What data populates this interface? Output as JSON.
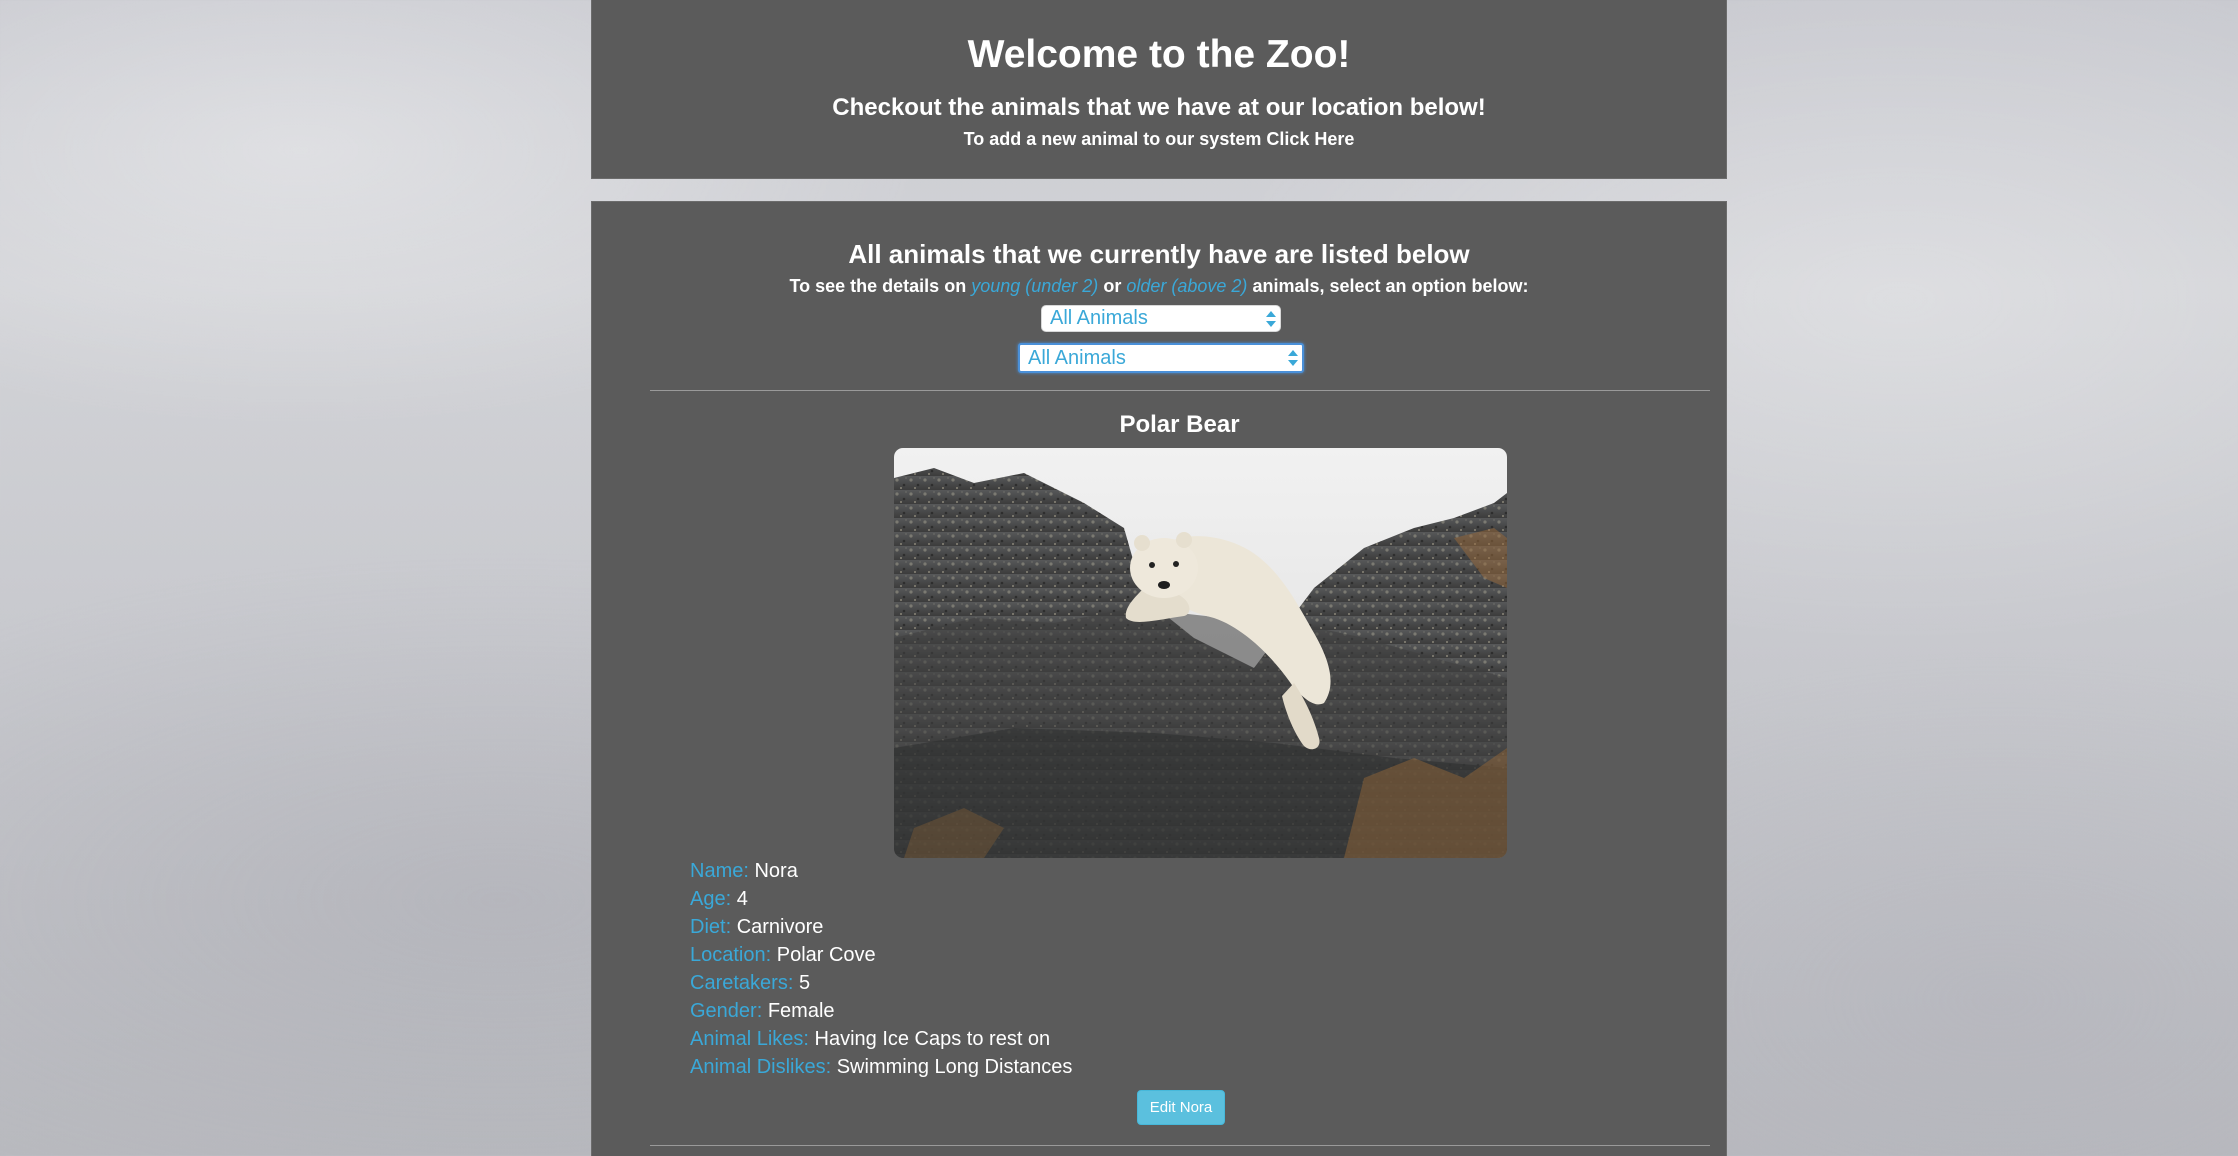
{
  "header": {
    "title": "Welcome to the Zoo!",
    "subtitle": "Checkout the animals that we have at our location below!",
    "add_text": "To add a new animal to our system Click Here"
  },
  "main": {
    "list_title": "All animals that we currently have are listed below",
    "filter_prefix": "To see the details on",
    "filter_young": "young (under 2)",
    "filter_or": "or",
    "filter_older": "older (above 2)",
    "filter_suffix": "animals, select an option below:",
    "select_1_value": "All Animals",
    "select_2_value": "All Animals"
  },
  "animal": {
    "species": "Polar Bear",
    "details": [
      {
        "label": "Name:",
        "value": "Nora"
      },
      {
        "label": "Age:",
        "value": "4"
      },
      {
        "label": "Diet:",
        "value": "Carnivore"
      },
      {
        "label": "Location:",
        "value": "Polar Cove"
      },
      {
        "label": "Caretakers:",
        "value": "5"
      },
      {
        "label": "Gender:",
        "value": "Female"
      },
      {
        "label": "Animal Likes:",
        "value": "Having Ice Caps to rest on"
      },
      {
        "label": "Animal Dislikes:",
        "value": "Swimming Long Distances"
      }
    ],
    "edit_label": "Edit Nora"
  },
  "colors": {
    "panel_bg": "#5b5b5b",
    "accent": "#3aa8d8",
    "button": "#5bc0de"
  }
}
